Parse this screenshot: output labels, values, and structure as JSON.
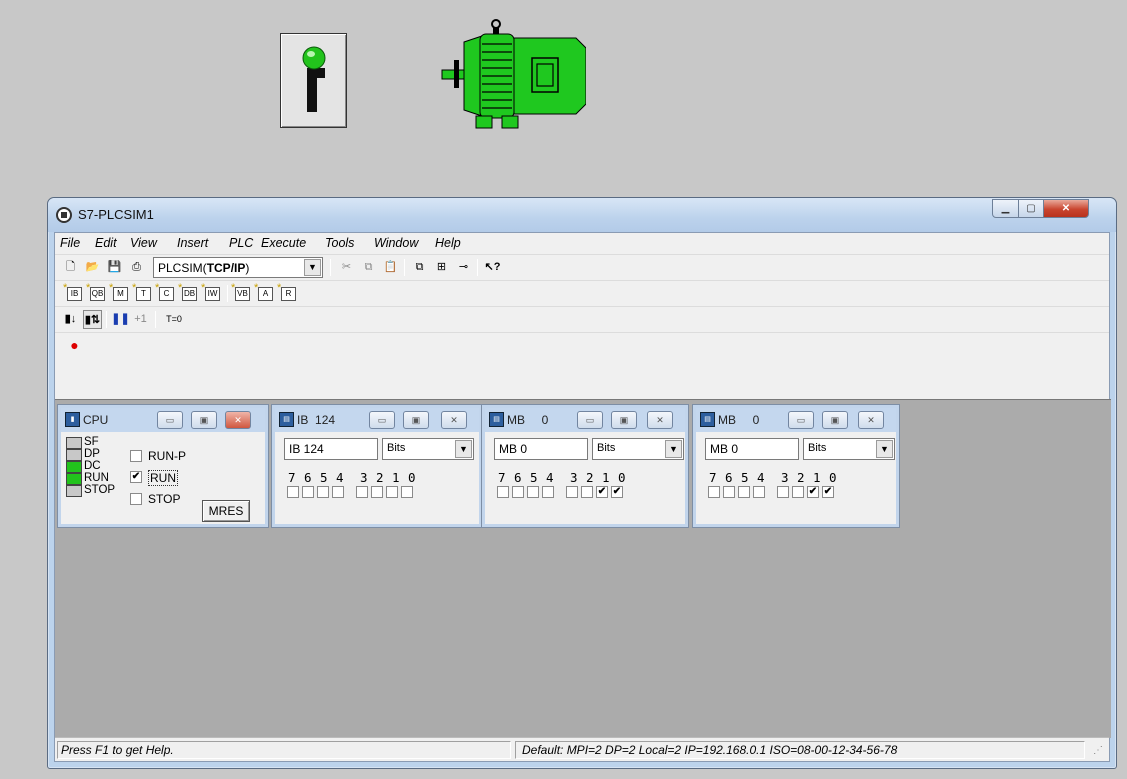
{
  "window": {
    "title": "S7-PLCSIM1"
  },
  "menu": [
    "File",
    "Edit",
    "View",
    "Insert",
    "PLC",
    "Execute",
    "Tools",
    "Window",
    "Help"
  ],
  "toolbar": {
    "connection_prefix": "PLCSIM(",
    "connection_bold": "TCP/IP",
    "connection_suffix": ")",
    "insert_icons": [
      "IB",
      "QB",
      "M",
      "T",
      "C",
      "DB",
      "IW",
      "VB",
      "A",
      "R"
    ],
    "step_label": "+1",
    "reset_timers_label": "T=0"
  },
  "cpu_panel": {
    "title": "CPU",
    "leds": [
      {
        "label": "SF",
        "color": "#c8c8c8"
      },
      {
        "label": "DP",
        "color": "#c8c8c8"
      },
      {
        "label": "DC",
        "color": "#22c31c"
      },
      {
        "label": "RUN",
        "color": "#22c31c"
      },
      {
        "label": "STOP",
        "color": "#c8c8c8"
      }
    ],
    "modes": [
      {
        "label": "RUN-P",
        "checked": false
      },
      {
        "label": "RUN",
        "checked": true
      },
      {
        "label": "STOP",
        "checked": false
      }
    ],
    "mres_label": "MRES"
  },
  "memory_panels": [
    {
      "title_type": "IB",
      "title_addr": "124",
      "address": "IB  124",
      "format": "Bits",
      "bits": [
        0,
        0,
        0,
        0,
        0,
        0,
        0,
        0
      ]
    },
    {
      "title_type": "MB",
      "title_addr": "0",
      "address": "MB   0",
      "format": "Bits",
      "bits": [
        0,
        0,
        0,
        0,
        0,
        0,
        1,
        1
      ]
    },
    {
      "title_type": "MB",
      "title_addr": "0",
      "address": "MB   0",
      "format": "Bits",
      "bits": [
        0,
        0,
        0,
        0,
        0,
        0,
        1,
        1
      ]
    }
  ],
  "bit_labels": [
    "7",
    "6",
    "5",
    "4",
    "3",
    "2",
    "1",
    "0"
  ],
  "status": {
    "help": "Press F1 to get Help.",
    "info": "Default:  MPI=2 DP=2 Local=2 IP=192.168.0.1 ISO=08-00-12-34-56-78"
  },
  "colors": {
    "motor_green": "#1fc81f",
    "led_green": "#22c31c",
    "workspace": "#ababab"
  }
}
